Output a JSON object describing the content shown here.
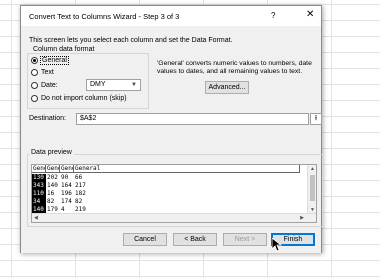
{
  "dialog": {
    "title": "Convert Text to Columns Wizard - Step 3 of 3",
    "help_label": "?",
    "close_label": "✕",
    "intro": "This screen lets you select each column and set the Data Format."
  },
  "column_format": {
    "legend": "Column data format",
    "options": [
      {
        "label": "General",
        "selected": true
      },
      {
        "label": "Text",
        "selected": false
      },
      {
        "label": "Date:",
        "selected": false
      },
      {
        "label": "Do not import column (skip)",
        "selected": false
      }
    ],
    "date_format": "DMY"
  },
  "description": "'General' converts numeric values to numbers, date values to dates, and all remaining values to text.",
  "advanced_label": "Advanced...",
  "destination": {
    "label": "Destination:",
    "value": "$A$2",
    "collapse_icon": "collapse-icon"
  },
  "preview": {
    "label": "Data preview",
    "headers": [
      "Gener",
      "Gener",
      "Gener",
      "General"
    ],
    "rows": [
      [
        "130",
        "202",
        "90",
        "66"
      ],
      [
        "343",
        "140",
        "164",
        "217"
      ],
      [
        "110",
        "16",
        "196",
        "182"
      ],
      [
        "34",
        "82",
        "174",
        "82"
      ],
      [
        "140",
        "179",
        "4",
        "219"
      ]
    ]
  },
  "buttons": {
    "cancel": "Cancel",
    "back": "< Back",
    "next": "Next >",
    "finish": "Finish"
  },
  "colors": {
    "dialog_bg": "#f0f0f0",
    "accent": "#0078d7"
  }
}
